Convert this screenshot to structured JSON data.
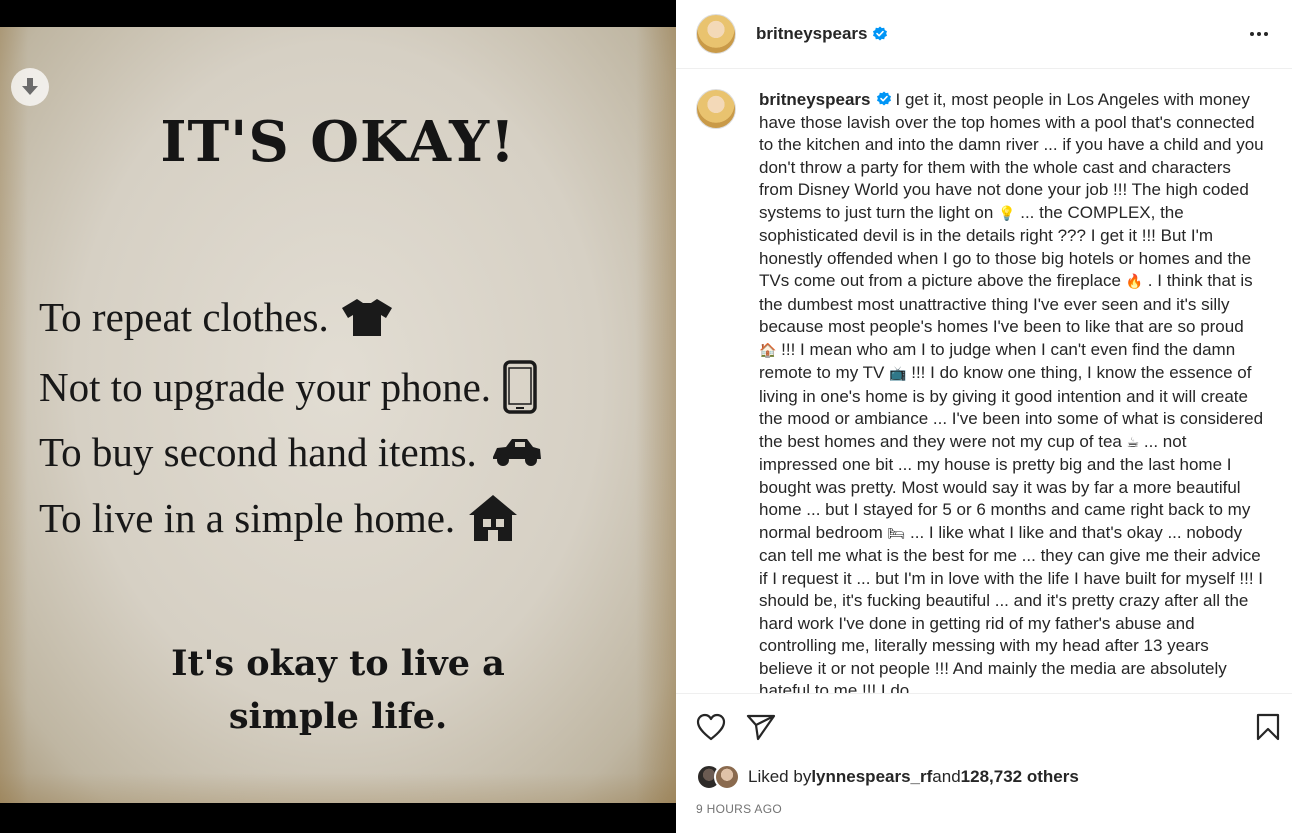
{
  "media": {
    "poster": {
      "title": "IT'S OKAY!",
      "lines": [
        {
          "text": "To repeat clothes.",
          "icon": "tshirt-icon"
        },
        {
          "text": "Not to upgrade your phone.",
          "icon": "phone-icon"
        },
        {
          "text": "To buy second hand items.",
          "icon": "car-icon"
        },
        {
          "text": "To live in a simple home.",
          "icon": "house-icon"
        }
      ],
      "footer_line1": "It's okay to live a",
      "footer_line2": "simple life."
    }
  },
  "post": {
    "username": "britneyspears",
    "verified": true,
    "caption": {
      "p1": "I get it, most people in Los Angeles with money have those lavish over the top homes with a pool that's connected to the kitchen and into the damn river ... if you have a child and you don't throw a party for them with the whole cast and characters from Disney World you have not done your job !!! The high coded systems to just turn the light on",
      "e1": "💡",
      "p2": " ... the COMPLEX, the sophisticated devil is in the details right ??? I get it !!! But I'm honestly offended when I go to those big hotels or homes and the TVs come out from a picture above the fireplace",
      "e2": "🔥",
      "p3": " . I think that is the dumbest most unattractive thing I've ever seen and it's silly because most people's homes I've been to like that are so proud",
      "e3": "🏠",
      "p4": " !!! I mean who am I to judge when I can't even find the damn remote to my TV",
      "e4": "📺",
      "p5": " !!! I do know one thing, I know the essence of living in one's home is by giving it good intention and it will create the mood or ambiance ... I've been into some of what is considered the best homes and they were not my cup of tea",
      "e5": "☕",
      "p6": " ... not impressed one bit ... my house is pretty big and the last home I bought was pretty. Most would say it was by far a more beautiful home ... but I stayed for 5 or 6 months and came right back to my normal bedroom",
      "e6": "🛏",
      "p7": " ... I like what I like and that's okay ... nobody can tell me what is the best for me ... they can give me their advice if I request it ... but I'm in love with the life I have built for myself !!! I should be, it's fucking beautiful ... and it's pretty crazy after all the hard work I've done in getting rid of my father's abuse and controlling me, literally messing with my head after 13 years believe it or not people !!! And mainly the media are absolutely hateful to me !!! I do"
    },
    "likes": {
      "prefix": "Liked by ",
      "liker": "lynnespears_rf",
      "middle": " and ",
      "count": "128,732 others"
    },
    "timestamp": "9 HOURS AGO"
  },
  "colors": {
    "verified_blue": "#0095f6",
    "text": "#262626",
    "muted": "#737373"
  }
}
